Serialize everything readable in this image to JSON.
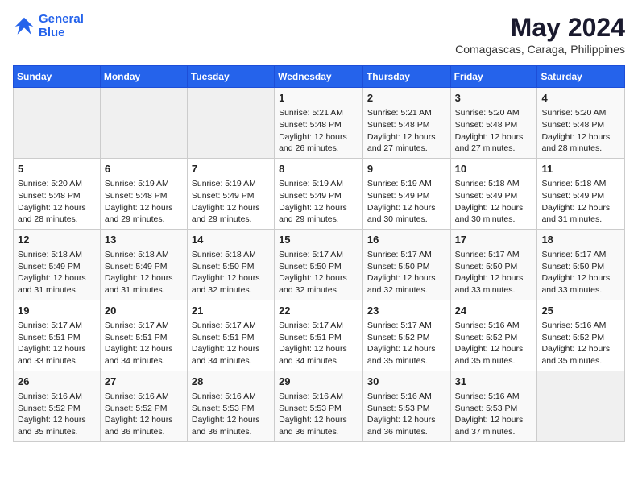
{
  "logo": {
    "line1": "General",
    "line2": "Blue"
  },
  "title": "May 2024",
  "subtitle": "Comagascas, Caraga, Philippines",
  "weekdays": [
    "Sunday",
    "Monday",
    "Tuesday",
    "Wednesday",
    "Thursday",
    "Friday",
    "Saturday"
  ],
  "weeks": [
    [
      {
        "day": "",
        "content": ""
      },
      {
        "day": "",
        "content": ""
      },
      {
        "day": "",
        "content": ""
      },
      {
        "day": "1",
        "content": "Sunrise: 5:21 AM\nSunset: 5:48 PM\nDaylight: 12 hours and 26 minutes."
      },
      {
        "day": "2",
        "content": "Sunrise: 5:21 AM\nSunset: 5:48 PM\nDaylight: 12 hours and 27 minutes."
      },
      {
        "day": "3",
        "content": "Sunrise: 5:20 AM\nSunset: 5:48 PM\nDaylight: 12 hours and 27 minutes."
      },
      {
        "day": "4",
        "content": "Sunrise: 5:20 AM\nSunset: 5:48 PM\nDaylight: 12 hours and 28 minutes."
      }
    ],
    [
      {
        "day": "5",
        "content": "Sunrise: 5:20 AM\nSunset: 5:48 PM\nDaylight: 12 hours and 28 minutes."
      },
      {
        "day": "6",
        "content": "Sunrise: 5:19 AM\nSunset: 5:48 PM\nDaylight: 12 hours and 29 minutes."
      },
      {
        "day": "7",
        "content": "Sunrise: 5:19 AM\nSunset: 5:49 PM\nDaylight: 12 hours and 29 minutes."
      },
      {
        "day": "8",
        "content": "Sunrise: 5:19 AM\nSunset: 5:49 PM\nDaylight: 12 hours and 29 minutes."
      },
      {
        "day": "9",
        "content": "Sunrise: 5:19 AM\nSunset: 5:49 PM\nDaylight: 12 hours and 30 minutes."
      },
      {
        "day": "10",
        "content": "Sunrise: 5:18 AM\nSunset: 5:49 PM\nDaylight: 12 hours and 30 minutes."
      },
      {
        "day": "11",
        "content": "Sunrise: 5:18 AM\nSunset: 5:49 PM\nDaylight: 12 hours and 31 minutes."
      }
    ],
    [
      {
        "day": "12",
        "content": "Sunrise: 5:18 AM\nSunset: 5:49 PM\nDaylight: 12 hours and 31 minutes."
      },
      {
        "day": "13",
        "content": "Sunrise: 5:18 AM\nSunset: 5:49 PM\nDaylight: 12 hours and 31 minutes."
      },
      {
        "day": "14",
        "content": "Sunrise: 5:18 AM\nSunset: 5:50 PM\nDaylight: 12 hours and 32 minutes."
      },
      {
        "day": "15",
        "content": "Sunrise: 5:17 AM\nSunset: 5:50 PM\nDaylight: 12 hours and 32 minutes."
      },
      {
        "day": "16",
        "content": "Sunrise: 5:17 AM\nSunset: 5:50 PM\nDaylight: 12 hours and 32 minutes."
      },
      {
        "day": "17",
        "content": "Sunrise: 5:17 AM\nSunset: 5:50 PM\nDaylight: 12 hours and 33 minutes."
      },
      {
        "day": "18",
        "content": "Sunrise: 5:17 AM\nSunset: 5:50 PM\nDaylight: 12 hours and 33 minutes."
      }
    ],
    [
      {
        "day": "19",
        "content": "Sunrise: 5:17 AM\nSunset: 5:51 PM\nDaylight: 12 hours and 33 minutes."
      },
      {
        "day": "20",
        "content": "Sunrise: 5:17 AM\nSunset: 5:51 PM\nDaylight: 12 hours and 34 minutes."
      },
      {
        "day": "21",
        "content": "Sunrise: 5:17 AM\nSunset: 5:51 PM\nDaylight: 12 hours and 34 minutes."
      },
      {
        "day": "22",
        "content": "Sunrise: 5:17 AM\nSunset: 5:51 PM\nDaylight: 12 hours and 34 minutes."
      },
      {
        "day": "23",
        "content": "Sunrise: 5:17 AM\nSunset: 5:52 PM\nDaylight: 12 hours and 35 minutes."
      },
      {
        "day": "24",
        "content": "Sunrise: 5:16 AM\nSunset: 5:52 PM\nDaylight: 12 hours and 35 minutes."
      },
      {
        "day": "25",
        "content": "Sunrise: 5:16 AM\nSunset: 5:52 PM\nDaylight: 12 hours and 35 minutes."
      }
    ],
    [
      {
        "day": "26",
        "content": "Sunrise: 5:16 AM\nSunset: 5:52 PM\nDaylight: 12 hours and 35 minutes."
      },
      {
        "day": "27",
        "content": "Sunrise: 5:16 AM\nSunset: 5:52 PM\nDaylight: 12 hours and 36 minutes."
      },
      {
        "day": "28",
        "content": "Sunrise: 5:16 AM\nSunset: 5:53 PM\nDaylight: 12 hours and 36 minutes."
      },
      {
        "day": "29",
        "content": "Sunrise: 5:16 AM\nSunset: 5:53 PM\nDaylight: 12 hours and 36 minutes."
      },
      {
        "day": "30",
        "content": "Sunrise: 5:16 AM\nSunset: 5:53 PM\nDaylight: 12 hours and 36 minutes."
      },
      {
        "day": "31",
        "content": "Sunrise: 5:16 AM\nSunset: 5:53 PM\nDaylight: 12 hours and 37 minutes."
      },
      {
        "day": "",
        "content": ""
      }
    ]
  ]
}
